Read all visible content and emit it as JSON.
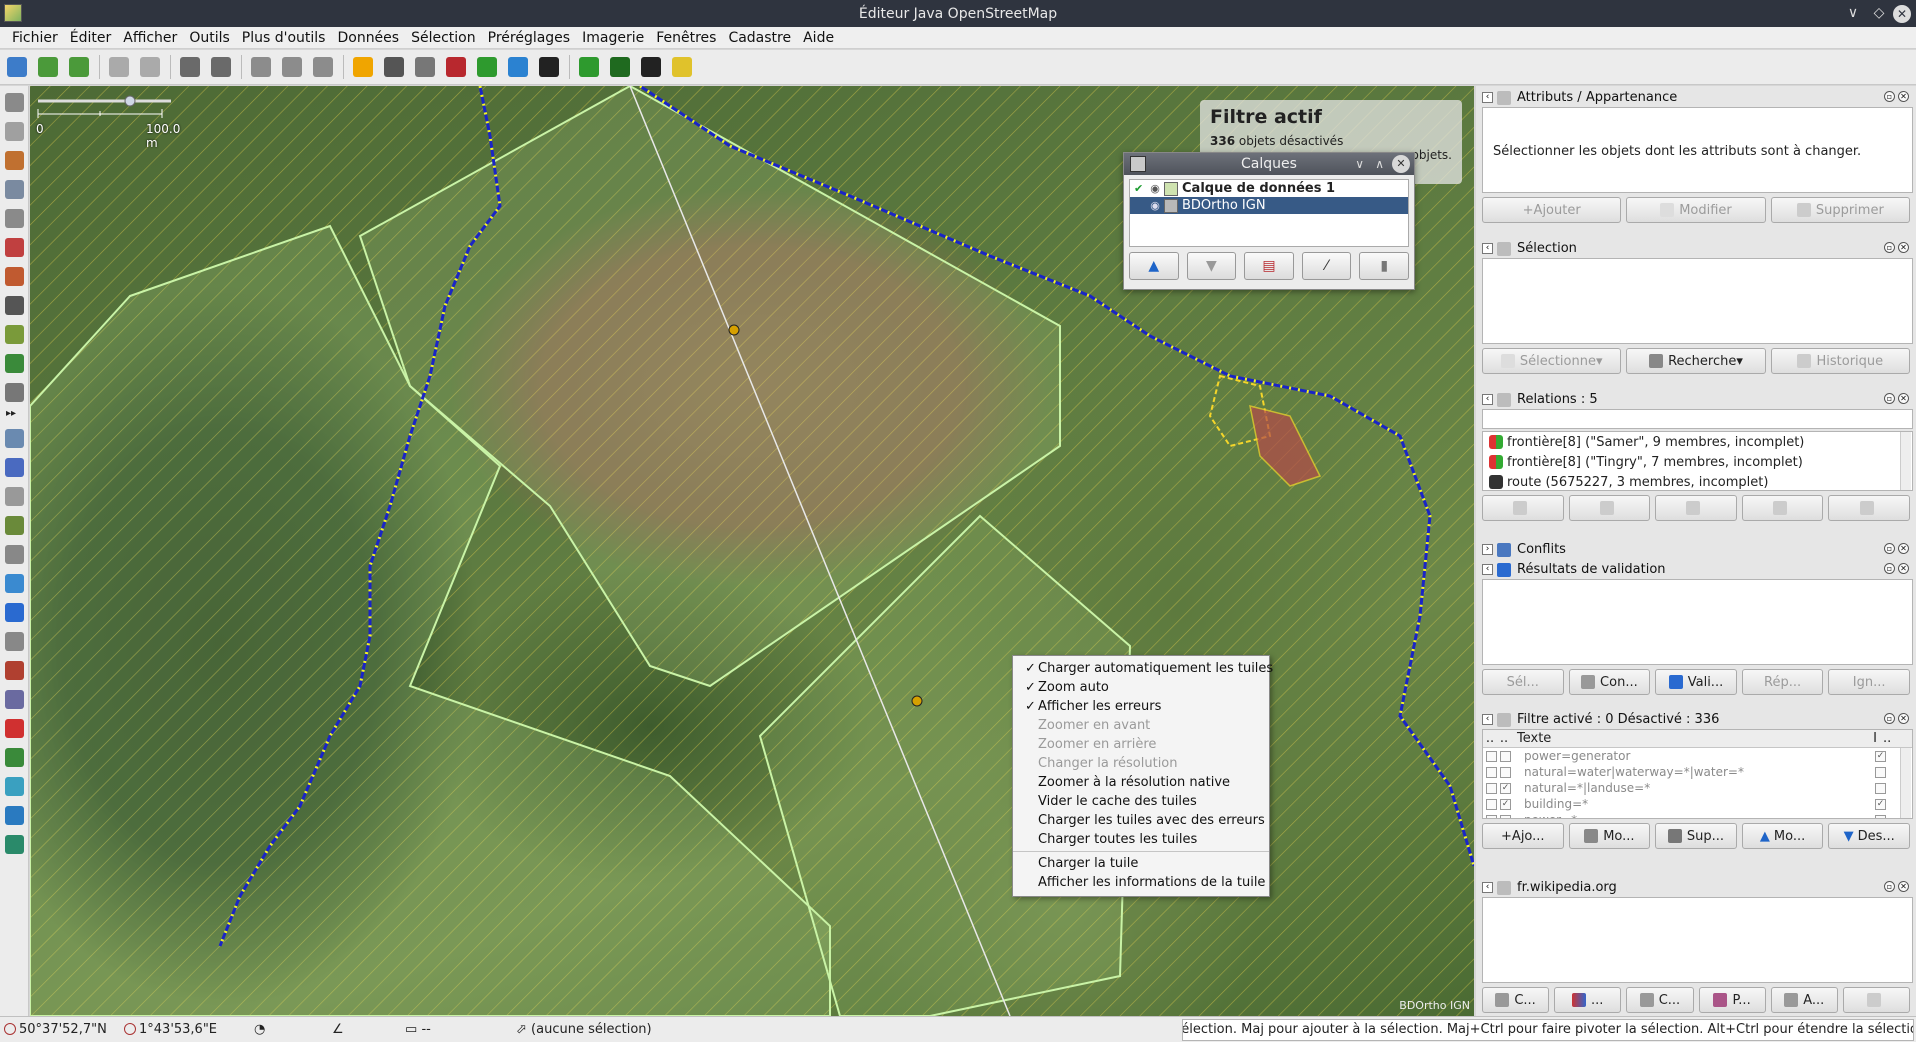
{
  "window": {
    "title": "Éditeur Java OpenStreetMap",
    "controls": [
      "∨",
      "◇",
      "✕"
    ]
  },
  "menu": [
    "Fichier",
    "Éditer",
    "Afficher",
    "Outils",
    "Plus d'outils",
    "Données",
    "Sélection",
    "Préréglages",
    "Imagerie",
    "Fenêtres",
    "Cadastre",
    "Aide"
  ],
  "toolbar_icons": [
    {
      "name": "open-file-icon",
      "color": "#3d7cc9"
    },
    {
      "name": "save-icon",
      "color": "#4b9a3a"
    },
    {
      "name": "upload-icon",
      "color": "#4b9a3a"
    },
    {
      "name": "undo-icon",
      "color": "#aaaaaa"
    },
    {
      "name": "redo-icon",
      "color": "#aaaaaa"
    },
    {
      "name": "preferences-icon",
      "color": "#6a6a6a"
    },
    {
      "name": "zoom-fit-icon",
      "color": "#6a6a6a"
    },
    {
      "name": "simplify-icon",
      "color": "#8c8c8c"
    },
    {
      "name": "split-way-icon",
      "color": "#8c8c8c"
    },
    {
      "name": "reload-icon",
      "color": "#8c8c8c"
    },
    {
      "name": "bar-icon",
      "color": "#f0a500"
    },
    {
      "name": "traffic-light-icon",
      "color": "#555555"
    },
    {
      "name": "street-lamp-icon",
      "color": "#777777"
    },
    {
      "name": "building-icon",
      "color": "#b8282e"
    },
    {
      "name": "forest-icon",
      "color": "#2e9a2e"
    },
    {
      "name": "water-icon",
      "color": "#2b82d1"
    },
    {
      "name": "car-icon",
      "color": "#222222"
    },
    {
      "name": "scrub-icon",
      "color": "#2e9a2e"
    },
    {
      "name": "trees-icon",
      "color": "#1f6a1f"
    },
    {
      "name": "tractor-icon",
      "color": "#222222"
    },
    {
      "name": "farmland-icon",
      "color": "#e0c22b"
    }
  ],
  "left_tools": [
    "select-tool-icon",
    "lasso-icon",
    "draw-line-icon",
    "zoom-tool-icon",
    "delete-tool-icon",
    "measure-icon",
    "parallel-icon",
    "improve-way-icon",
    "extrude-icon",
    "expand-icon",
    "layers-toggle-icon",
    "tag-tool-icon",
    "relation-tool-icon",
    "selection-list-icon",
    "commands-icon",
    "conflict-tool-icon",
    "image-tool-icon",
    "validation-icon",
    "filter-icon",
    "history-icon",
    "plugin-icon",
    "notes-icon",
    "mapillary-icon",
    "gps-icon",
    "info-icon",
    "time-icon"
  ],
  "map": {
    "scale_label": "100.0 m",
    "scale_zero": "0",
    "attribution": "BDOrtho IGN",
    "filter": {
      "title": "Filtre actif",
      "count": "336",
      "line1": "objets désactivés",
      "line2": "objets."
    }
  },
  "layers_dialog": {
    "title": "Calques",
    "rows": [
      {
        "label": "Calque de données 1",
        "active": true,
        "selected": false
      },
      {
        "label": "BDOrtho IGN",
        "active": false,
        "selected": true
      }
    ],
    "buttons": [
      "arrow-up-icon",
      "arrow-down-icon",
      "merge-icon",
      "opacity-icon",
      "delete-layer-icon"
    ]
  },
  "context_menu": [
    {
      "label": "Charger automatiquement les tuiles",
      "checked": true,
      "disabled": false
    },
    {
      "label": "Zoom auto",
      "checked": true,
      "disabled": false
    },
    {
      "label": "Afficher les erreurs",
      "checked": true,
      "disabled": false
    },
    {
      "label": "Zoomer en avant",
      "checked": false,
      "disabled": true
    },
    {
      "label": "Zoomer en arrière",
      "checked": false,
      "disabled": true
    },
    {
      "label": "Changer la résolution",
      "checked": false,
      "disabled": true
    },
    {
      "label": "Zoomer à la résolution native",
      "checked": false,
      "disabled": false
    },
    {
      "label": "Vider le cache des tuiles",
      "checked": false,
      "disabled": false
    },
    {
      "label": "Charger les tuiles avec des erreurs",
      "checked": false,
      "disabled": false
    },
    {
      "label": "Charger toutes les tuiles",
      "checked": false,
      "disabled": false,
      "sep_after": true
    },
    {
      "label": "Charger la tuile",
      "checked": false,
      "disabled": false
    },
    {
      "label": "Afficher les informations de la tuile",
      "checked": false,
      "disabled": false
    }
  ],
  "status": {
    "lat": "50°37'52,7\"N",
    "lon": "1°43'53,6\"E",
    "distance": "--",
    "selection": "(aucune sélection)",
    "help": "Cliquer pour sélectionner. Shift+clic pour ajouter à la sélection. Maj pour ajouter à la sélection. Maj+Ctrl pour faire pivoter la sélection. Alt+Ctrl pour étendre la sélection."
  },
  "panels": {
    "attributes": {
      "title": "Attributs / Appartenance",
      "message": "Sélectionner les objets dont les attributs sont à changer.",
      "buttons": [
        {
          "label": "Ajouter"
        },
        {
          "label": "Modifier"
        },
        {
          "label": "Supprimer"
        }
      ]
    },
    "selection": {
      "title": "Sélection",
      "buttons": [
        {
          "label": "Sélectionne▾",
          "disabled": true
        },
        {
          "label": "Recherche▾",
          "disabled": false
        },
        {
          "label": "Historique",
          "disabled": true
        }
      ]
    },
    "relations": {
      "title": "Relations : 5",
      "rows": [
        {
          "label": "frontière[8] (\"Samer\", 9 membres, incomplet)",
          "icon": "boundary-icon"
        },
        {
          "label": "frontière[8] (\"Tingry\", 7 membres, incomplet)",
          "icon": "boundary-icon"
        },
        {
          "label": "route (5675227, 3 membres, incomplet)",
          "icon": "route-icon"
        }
      ]
    },
    "conflicts": {
      "title": "Conflits"
    },
    "validation": {
      "title": "Résultats de validation",
      "buttons": [
        {
          "label": "Sél...",
          "disabled": true
        },
        {
          "label": "Con...",
          "disabled": false
        },
        {
          "label": "Vali...",
          "disabled": false
        },
        {
          "label": "Rép...",
          "disabled": true
        },
        {
          "label": "Ign...",
          "disabled": true
        }
      ]
    },
    "filter": {
      "title": "Filtre activé : 0 Désactivé : 336",
      "col_text": "Texte",
      "col_i": "I",
      "col_dots": "..",
      "rows": [
        {
          "text": "power=generator",
          "enabled": false,
          "inverted": true
        },
        {
          "text": "natural=water|waterway=*|water=*",
          "enabled": false,
          "inverted": false
        },
        {
          "text": "natural=*|landuse=*",
          "enabled": true,
          "inverted": false
        },
        {
          "text": "building=*",
          "enabled": true,
          "inverted": true
        },
        {
          "text": "power=*",
          "enabled": false,
          "inverted": false
        }
      ],
      "buttons": [
        {
          "label": "Ajo..."
        },
        {
          "label": "Mo..."
        },
        {
          "label": "Sup..."
        },
        {
          "label": "Mo..."
        },
        {
          "label": "Des..."
        }
      ]
    },
    "wikipedia": {
      "title": "fr.wikipedia.org",
      "buttons": [
        {
          "label": "C..."
        },
        {
          "label": "..."
        },
        {
          "label": "C..."
        },
        {
          "label": "P..."
        },
        {
          "label": "A..."
        },
        {
          "label": ""
        }
      ]
    }
  }
}
